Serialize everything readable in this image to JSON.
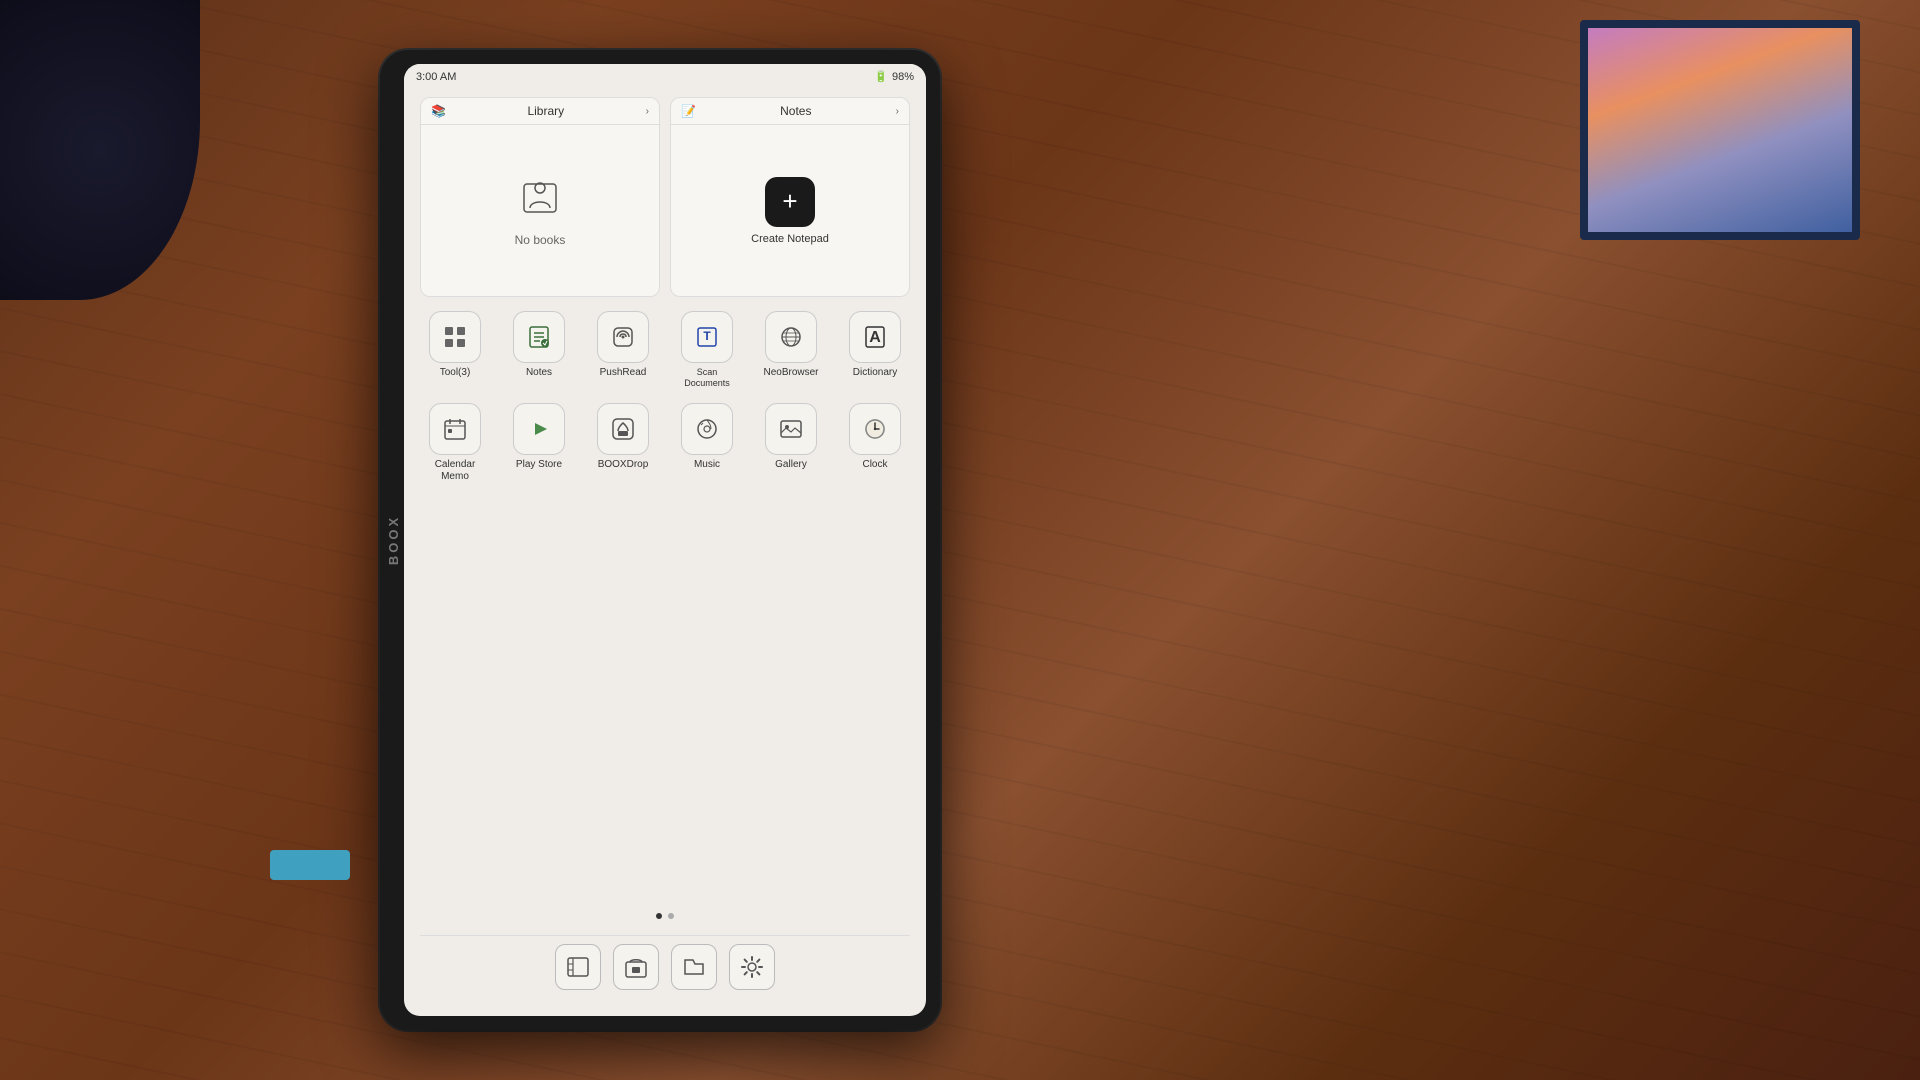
{
  "background": {
    "color": "#5c3018"
  },
  "tablet": {
    "brand": "BOOX",
    "status_bar": {
      "time": "3:00 AM",
      "battery_percent": "98%",
      "battery_icon": "🔋"
    },
    "widgets": {
      "library": {
        "title": "Library",
        "body_text": "No books",
        "arrow": "›"
      },
      "notes": {
        "title": "Notes",
        "arrow": "›",
        "create_button": "Create Notepad"
      }
    },
    "app_rows": [
      [
        {
          "id": "tools",
          "label": "Tool(3)",
          "icon": "⚙"
        },
        {
          "id": "notes",
          "label": "Notes",
          "icon": "📝"
        },
        {
          "id": "pushread",
          "label": "PushRead",
          "icon": "📡"
        },
        {
          "id": "scan",
          "label": "Scan Documents",
          "icon": "📄"
        },
        {
          "id": "neobrowser",
          "label": "NeoBrowser",
          "icon": "🌐"
        },
        {
          "id": "dictionary",
          "label": "Dictionary",
          "icon": "A"
        }
      ],
      [
        {
          "id": "calendar",
          "label": "Calendar Memo",
          "icon": "📅"
        },
        {
          "id": "playstore",
          "label": "Play Store",
          "icon": "▶"
        },
        {
          "id": "booxdrop",
          "label": "BOOXDrop",
          "icon": "📦"
        },
        {
          "id": "music",
          "label": "Music",
          "icon": "🎵"
        },
        {
          "id": "gallery",
          "label": "Gallery",
          "icon": "🖼"
        },
        {
          "id": "clock",
          "label": "Clock",
          "icon": "🕐"
        }
      ]
    ],
    "page_dots": [
      {
        "active": true
      },
      {
        "active": false
      }
    ],
    "dock": [
      {
        "id": "library-dock",
        "icon": "📚"
      },
      {
        "id": "store-dock",
        "icon": "🏪"
      },
      {
        "id": "files-dock",
        "icon": "📁"
      },
      {
        "id": "settings-dock",
        "icon": "⚙"
      }
    ]
  }
}
